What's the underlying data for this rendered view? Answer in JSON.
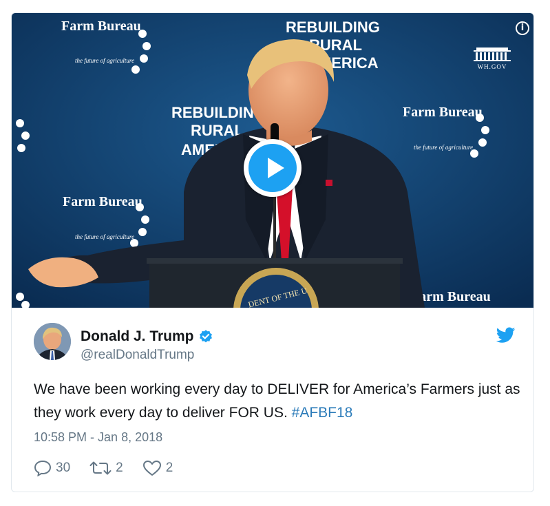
{
  "media": {
    "backdrop_texts": [
      "REBUILDING",
      "RURAL",
      "AMERICA"
    ],
    "brand": "Farm Bureau",
    "brand_tagline": "the future of agriculture",
    "seal_text": "DENT OF THE U",
    "watermark": "WH.GOV",
    "info_icon": "i",
    "colors": {
      "backdrop": "#0f3a66",
      "play": "#1da1f2",
      "tie": "#d4102a",
      "suit": "#1a2230"
    }
  },
  "tweet": {
    "author_name": "Donald J. Trump",
    "author_handle": "@realDonaldTrump",
    "text_main": "We have been working every day to DELIVER for America’s Farmers just as they work every day to deliver FOR US.",
    "hashtag": "#AFBF18",
    "timestamp": "10:58 PM - Jan 8, 2018",
    "replies": "30",
    "retweets": "2",
    "likes": "2",
    "colors": {
      "accent": "#1da1f2",
      "link": "#2b7bb9",
      "muted": "#657786"
    }
  },
  "icons": {
    "verified": "verified-badge-icon",
    "bird": "twitter-bird-icon",
    "reply": "reply-bubble-icon",
    "retweet": "retweet-arrows-icon",
    "like": "heart-icon",
    "play": "play-icon",
    "info": "info-icon"
  }
}
